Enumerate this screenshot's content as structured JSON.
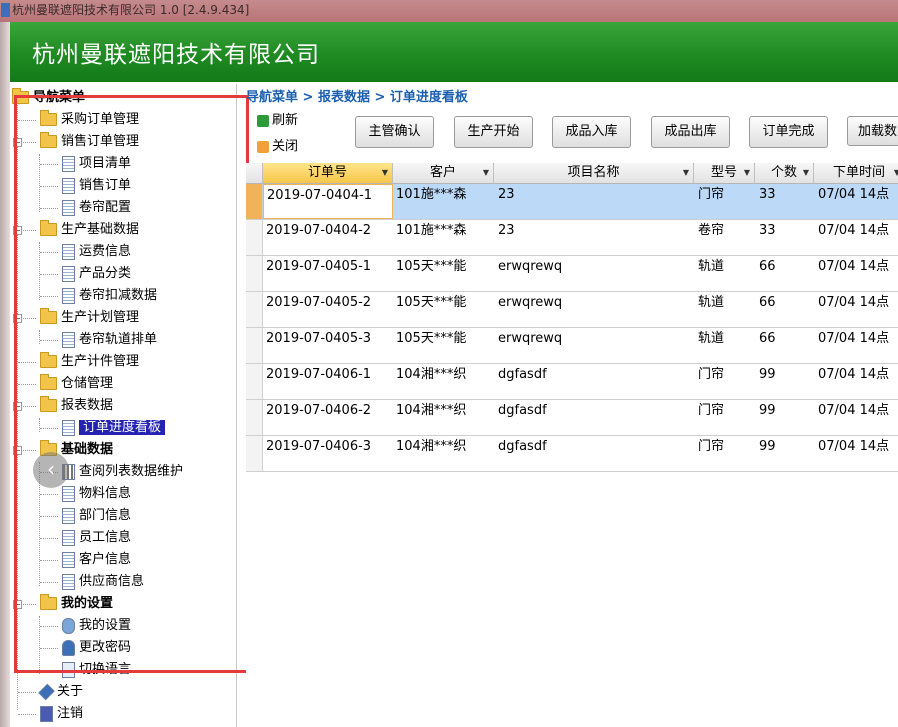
{
  "window": {
    "title": "杭州曼联遮阳技术有限公司 1.0 [2.4.9.434]"
  },
  "banner": {
    "company": "杭州曼联遮阳技术有限公司"
  },
  "tree": {
    "root": "导航菜单",
    "nodes": [
      {
        "label": "采购订单管理",
        "icon": "folder-icon"
      },
      {
        "label": "销售订单管理",
        "icon": "folder-icon"
      },
      {
        "label": "项目清单",
        "icon": "document-icon"
      },
      {
        "label": "销售订单",
        "icon": "document-icon"
      },
      {
        "label": "卷帘配置",
        "icon": "document-icon"
      },
      {
        "label": "生产基础数据",
        "icon": "folder-icon"
      },
      {
        "label": "运费信息",
        "icon": "document-icon"
      },
      {
        "label": "产品分类",
        "icon": "document-icon"
      },
      {
        "label": "卷帘扣减数据",
        "icon": "document-icon"
      },
      {
        "label": "生产计划管理",
        "icon": "folder-icon"
      },
      {
        "label": "卷帘轨道排单",
        "icon": "document-icon"
      },
      {
        "label": "生产计件管理",
        "icon": "folder-icon"
      },
      {
        "label": "仓储管理",
        "icon": "folder-icon"
      },
      {
        "label": "报表数据",
        "icon": "folder-icon"
      },
      {
        "label": "订单进度看板",
        "icon": "document-icon"
      },
      {
        "label": "基础数据",
        "icon": "folder-icon"
      },
      {
        "label": "查阅列表数据维护",
        "icon": "grid-icon"
      },
      {
        "label": "物料信息",
        "icon": "document-icon"
      },
      {
        "label": "部门信息",
        "icon": "document-icon"
      },
      {
        "label": "员工信息",
        "icon": "document-icon"
      },
      {
        "label": "客户信息",
        "icon": "document-icon"
      },
      {
        "label": "供应商信息",
        "icon": "document-icon"
      },
      {
        "label": "我的设置",
        "icon": "folder-icon"
      },
      {
        "label": "我的设置",
        "icon": "settings-icon"
      },
      {
        "label": "更改密码",
        "icon": "user-key-icon"
      },
      {
        "label": "切换语言",
        "icon": "language-icon"
      },
      {
        "label": "关于",
        "icon": "info-icon"
      },
      {
        "label": "注销",
        "icon": "logout-icon"
      }
    ]
  },
  "breadcrumb": "导航菜单 > 报表数据 > 订单进度看板",
  "toolbar": {
    "refresh": "刷新",
    "close": "关闭",
    "buttons": [
      "主管确认",
      "生产开始",
      "成品入库",
      "成品出库",
      "订单完成",
      "加载数"
    ]
  },
  "grid": {
    "columns": [
      "订单号",
      "客户",
      "项目名称",
      "型号",
      "个数",
      "下单时间"
    ],
    "rows": [
      [
        "2019-07-0404-1",
        "101施***森",
        "23",
        "门帘",
        "33",
        "07/04  14点"
      ],
      [
        "2019-07-0404-2",
        "101施***森",
        "23",
        "卷帘",
        "33",
        "07/04  14点"
      ],
      [
        "2019-07-0405-1",
        "105天***能",
        "erwqrewq",
        "轨道",
        "66",
        "07/04  14点"
      ],
      [
        "2019-07-0405-2",
        "105天***能",
        "erwqrewq",
        "轨道",
        "66",
        "07/04  14点"
      ],
      [
        "2019-07-0405-3",
        "105天***能",
        "erwqrewq",
        "轨道",
        "66",
        "07/04  14点"
      ],
      [
        "2019-07-0406-1",
        "104湘***织",
        "dgfasdf",
        "门帘",
        "99",
        "07/04  14点"
      ],
      [
        "2019-07-0406-2",
        "104湘***织",
        "dgfasdf",
        "门帘",
        "99",
        "07/04  14点"
      ],
      [
        "2019-07-0406-3",
        "104湘***织",
        "dgfasdf",
        "门帘",
        "99",
        "07/04  14点"
      ]
    ]
  },
  "colors": {
    "banner": "#1f8a22",
    "selection": "#bcd9f7",
    "tree_selected": "#2424b0",
    "highlight_box": "#e33b3b"
  }
}
